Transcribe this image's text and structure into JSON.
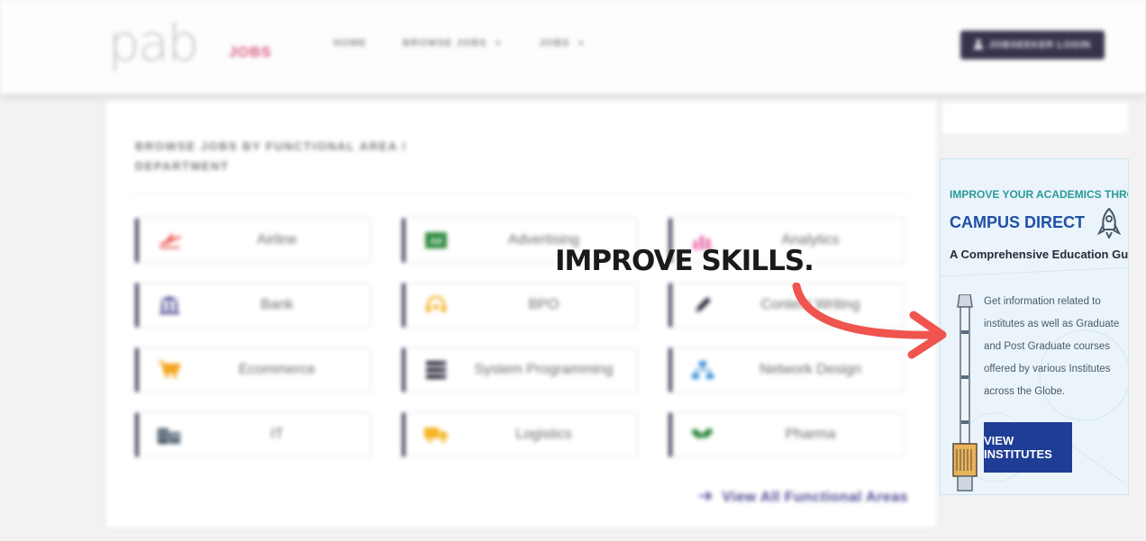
{
  "header": {
    "logo_text": "pab",
    "logo_sub": "JOBS",
    "nav": [
      {
        "label": "HOME",
        "has_caret": false
      },
      {
        "label": "BROWSE JOBS",
        "has_caret": true
      },
      {
        "label": "JOBS",
        "has_caret": true
      }
    ],
    "action_button": "JOBSEEKER LOGIN",
    "action_icon": "user-icon"
  },
  "main": {
    "section_title": "BROWSE JOBS BY FUNCTIONAL AREA / DEPARTMENT",
    "areas": [
      {
        "label": "Airline",
        "icon": "airplane-icon",
        "color": "#e8433f"
      },
      {
        "label": "Advertising",
        "icon": "ad-icon",
        "color": "#2e8b3d"
      },
      {
        "label": "Analytics",
        "icon": "chart-icon",
        "color": "#e85aa0"
      },
      {
        "label": "Bank",
        "icon": "bank-icon",
        "color": "#4a4790"
      },
      {
        "label": "BPO",
        "icon": "headset-icon",
        "color": "#f5b21c"
      },
      {
        "label": "Content Writing",
        "icon": "pen-icon",
        "color": "#2a2a3a"
      },
      {
        "label": "Ecommerce",
        "icon": "cart-icon",
        "color": "#f5a41c"
      },
      {
        "label": "System Programming",
        "icon": "server-icon",
        "color": "#2a2a3a"
      },
      {
        "label": "Network Design",
        "icon": "network-icon",
        "color": "#3a8fd8"
      },
      {
        "label": "IT",
        "icon": "building-icon",
        "color": "#3a4a5a"
      },
      {
        "label": "Logistics",
        "icon": "truck-icon",
        "color": "#f5b21c"
      },
      {
        "label": "Pharma",
        "icon": "pills-icon",
        "color": "#2e8b3d"
      }
    ],
    "view_all": "View All Functional Areas",
    "view_all_icon": "arrow-right-icon"
  },
  "ad": {
    "line1": "IMPROVE YOUR ACADEMICS THROUGH",
    "line2": "CAMPUS DIRECT",
    "line3": "A Comprehensive Education Guide!",
    "body": "Get information related to institutes as well as Graduate and Post Graduate courses offered by various Institutes across the Globe.",
    "button": "VIEW INSTITUTES",
    "rocket_icon": "rocket-icon"
  },
  "overlay": {
    "text": "IMPROVE SKILLS.",
    "arrow_color": "#f0544f"
  }
}
